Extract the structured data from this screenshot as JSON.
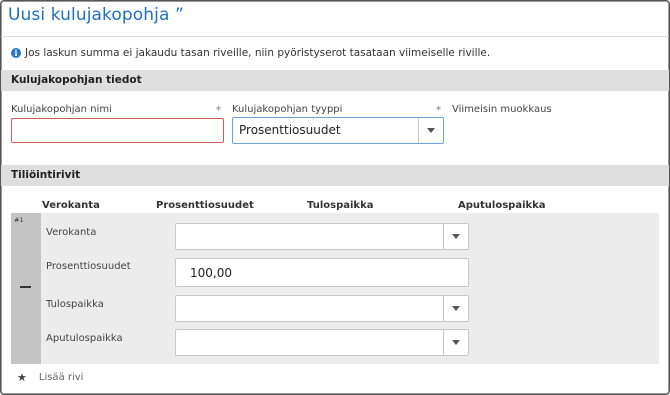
{
  "page": {
    "title": "Uusi kulujakopohja ”"
  },
  "info": {
    "icon": "info-icon",
    "text": "Jos laskun summa ei jakaudu tasan riveille, niin pyöristyserot tasataan viimeiselle riville."
  },
  "sections": {
    "details_title": "Kulujakopohjan tiedot",
    "rows_title": "Tiliöintirivit"
  },
  "form": {
    "name_label": "Kulujakopohjan nimi",
    "name_required": "*",
    "name_value": "",
    "type_label": "Kulujakopohjan tyyppi",
    "type_required": "*",
    "type_value": "Prosenttiosuudet",
    "modified_label": "Viimeisin muokkaus"
  },
  "columns": [
    "Verokanta",
    "Prosenttiosuudet",
    "Tulospaikka",
    "Aputulospaikka"
  ],
  "row": {
    "number": "#1",
    "fields": {
      "vat_label": "Verokanta",
      "vat_value": "",
      "percent_label": "Prosenttiosuudet",
      "percent_value": "100,00",
      "cost_center_label": "Tulospaikka",
      "cost_center_value": "",
      "aux_cost_center_label": "Aputulospaikka",
      "aux_cost_center_value": ""
    }
  },
  "actions": {
    "add_row_label": "Lisää rivi",
    "add_row_icon": "star-icon"
  },
  "colors": {
    "title": "#1f6fc5",
    "info_icon": "#2a74c9",
    "error_border": "#d35a5a",
    "focus_border": "#6ea2d8",
    "section_bar": "#dedede"
  }
}
